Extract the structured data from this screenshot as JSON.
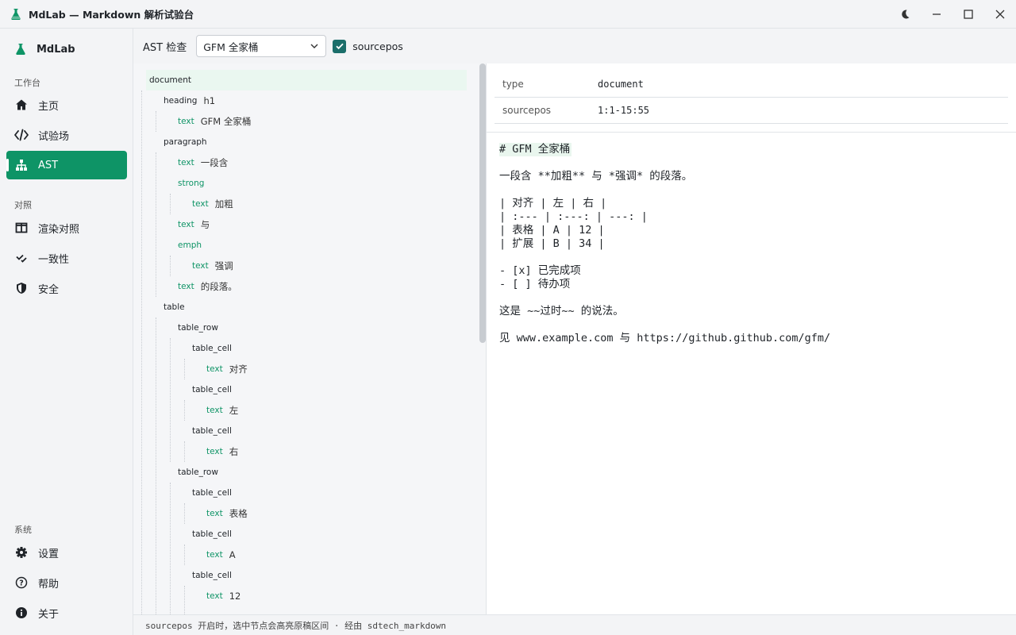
{
  "window": {
    "title": "MdLab — Markdown 解析试验台",
    "controls": [
      "theme-toggle",
      "minimize",
      "maximize",
      "close"
    ]
  },
  "sidebar": {
    "brand": "MdLab",
    "sections": [
      {
        "label": "工作台",
        "items": [
          {
            "label": "主页",
            "icon": "home-icon"
          },
          {
            "label": "试验场",
            "icon": "code-icon"
          },
          {
            "label": "AST",
            "icon": "tree-icon",
            "active": true
          }
        ]
      },
      {
        "label": "对照",
        "items": [
          {
            "label": "渲染对照",
            "icon": "columns-icon"
          },
          {
            "label": "一致性",
            "icon": "check-icon"
          },
          {
            "label": "安全",
            "icon": "shield-icon"
          }
        ]
      },
      {
        "label": "系统",
        "items": [
          {
            "label": "设置",
            "icon": "gear-icon"
          },
          {
            "label": "帮助",
            "icon": "help-icon"
          },
          {
            "label": "关于",
            "icon": "info-icon"
          }
        ]
      }
    ]
  },
  "toolbar": {
    "label": "AST 检查",
    "preset": "GFM 全家桶",
    "sourcepos_checked": true,
    "sourcepos_label": "sourcepos"
  },
  "tree": [
    {
      "kind": "document",
      "text": "",
      "depth": 0,
      "selected": true
    },
    {
      "kind": "heading",
      "text": "h1",
      "depth": 1
    },
    {
      "kind": "text",
      "text": "GFM 全家桶",
      "depth": 2,
      "leaf": true
    },
    {
      "kind": "paragraph",
      "text": "",
      "depth": 1
    },
    {
      "kind": "text",
      "text": "一段含",
      "depth": 2,
      "leaf": true
    },
    {
      "kind": "strong",
      "text": "",
      "depth": 2,
      "leaf": true
    },
    {
      "kind": "text",
      "text": "加粗",
      "depth": 3,
      "leaf": true
    },
    {
      "kind": "text",
      "text": "与",
      "depth": 2,
      "leaf": true
    },
    {
      "kind": "emph",
      "text": "",
      "depth": 2,
      "leaf": true
    },
    {
      "kind": "text",
      "text": "强调",
      "depth": 3,
      "leaf": true
    },
    {
      "kind": "text",
      "text": "的段落。",
      "depth": 2,
      "leaf": true
    },
    {
      "kind": "table",
      "text": "",
      "depth": 1
    },
    {
      "kind": "table_row",
      "text": "",
      "depth": 2
    },
    {
      "kind": "table_cell",
      "text": "",
      "depth": 3
    },
    {
      "kind": "text",
      "text": "对齐",
      "depth": 4,
      "leaf": true
    },
    {
      "kind": "table_cell",
      "text": "",
      "depth": 3
    },
    {
      "kind": "text",
      "text": "左",
      "depth": 4,
      "leaf": true
    },
    {
      "kind": "table_cell",
      "text": "",
      "depth": 3
    },
    {
      "kind": "text",
      "text": "右",
      "depth": 4,
      "leaf": true
    },
    {
      "kind": "table_row",
      "text": "",
      "depth": 2
    },
    {
      "kind": "table_cell",
      "text": "",
      "depth": 3
    },
    {
      "kind": "text",
      "text": "表格",
      "depth": 4,
      "leaf": true
    },
    {
      "kind": "table_cell",
      "text": "",
      "depth": 3
    },
    {
      "kind": "text",
      "text": "A",
      "depth": 4,
      "leaf": true
    },
    {
      "kind": "table_cell",
      "text": "",
      "depth": 3
    },
    {
      "kind": "text",
      "text": "12",
      "depth": 4,
      "leaf": true
    }
  ],
  "properties": [
    {
      "key": "type",
      "value": "document"
    },
    {
      "key": "sourcepos",
      "value": "1:1-15:55"
    }
  ],
  "source": [
    {
      "text": "# GFM 全家桶",
      "highlight": true
    },
    {
      "text": ""
    },
    {
      "text": "一段含 **加粗** 与 *强调* 的段落。"
    },
    {
      "text": ""
    },
    {
      "text": "| 对齐 | 左 | 右 |"
    },
    {
      "text": "| :--- | :---: | ---: |"
    },
    {
      "text": "| 表格 | A | 12 |"
    },
    {
      "text": "| 扩展 | B | 34 |"
    },
    {
      "text": ""
    },
    {
      "text": "- [x] 已完成项"
    },
    {
      "text": "- [ ] 待办项"
    },
    {
      "text": ""
    },
    {
      "text": "这是 ~~过时~~ 的说法。"
    },
    {
      "text": ""
    },
    {
      "text": "见 www.example.com 与 https://github.github.com/gfm/"
    }
  ],
  "status": "sourcepos 开启时，选中节点会高亮原稿区间 · 经由 sdtech_markdown"
}
